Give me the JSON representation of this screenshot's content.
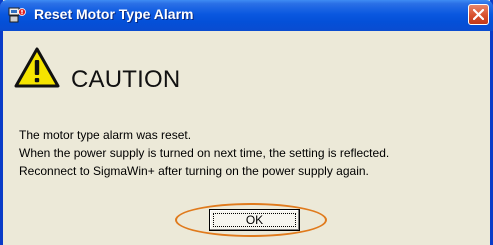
{
  "window": {
    "title": "Reset Motor Type Alarm",
    "app_icon": "motor-settings-icon",
    "close_icon": "close-icon",
    "colors": {
      "titlebar": "#0a58e0",
      "body": "#ece9d8",
      "close_button": "#d8502c",
      "highlight_ring": "#e07a1c"
    }
  },
  "dialog": {
    "icon": "warning-icon",
    "heading": "CAUTION",
    "messages": [
      "The motor type alarm was reset.",
      "When the power supply is turned on next time, the setting is reflected.",
      "Reconnect to SigmaWin+ after turning on the power supply again."
    ],
    "ok_label": "OK"
  }
}
